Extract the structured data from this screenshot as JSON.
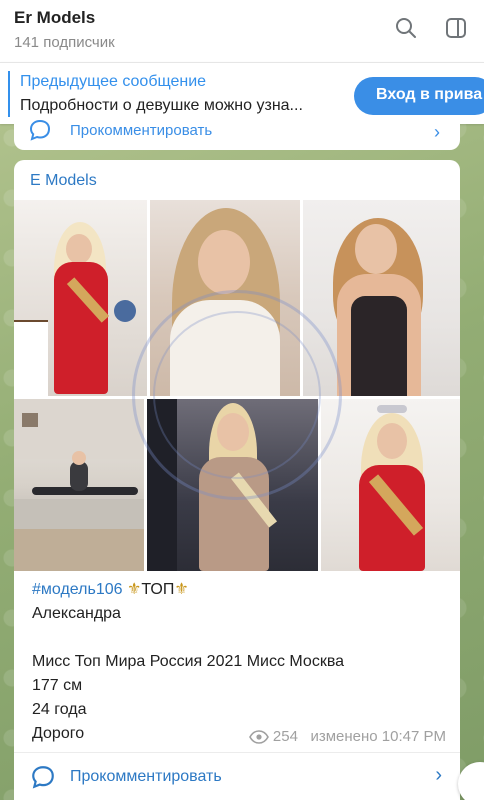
{
  "header": {
    "channel_name": "Er      Models",
    "subscribers": "141 подписчик",
    "search_icon": "search-icon",
    "panel_icon": "sidebar-panel-icon"
  },
  "pinned": {
    "title": "Предыдущее сообщение",
    "text": "Подробности о девушке можно узна...",
    "button_label": "Вход в прива"
  },
  "prev_comment": {
    "label": "Прокомментировать",
    "icon": "comment-icon"
  },
  "message": {
    "author": "E         Models",
    "hashtag": "#модель106",
    "fleur_left": "⚜",
    "top_label": "ТОП",
    "fleur_right": "⚜",
    "name": "Александра",
    "title_line": "Мисс Топ Мира Россия 2021 Мисс Москва",
    "height": "177 см",
    "age": "24 года",
    "price": "Дорого",
    "views": "254",
    "edited": "изменено 10:47 PM",
    "photos": [
      {
        "name": "photo-1"
      },
      {
        "name": "photo-2"
      },
      {
        "name": "photo-3"
      },
      {
        "name": "photo-4"
      },
      {
        "name": "photo-5"
      },
      {
        "name": "photo-6"
      }
    ],
    "watermark_texts": [
      "E      ATE CITY",
      "POLICE"
    ]
  },
  "comment_bar": {
    "label": "Прокомментировать",
    "chevron": "›"
  },
  "colors": {
    "accent": "#3390ec",
    "link": "#2d79c4",
    "fleur": "#c9971c",
    "header_bg": "#ffffff"
  }
}
